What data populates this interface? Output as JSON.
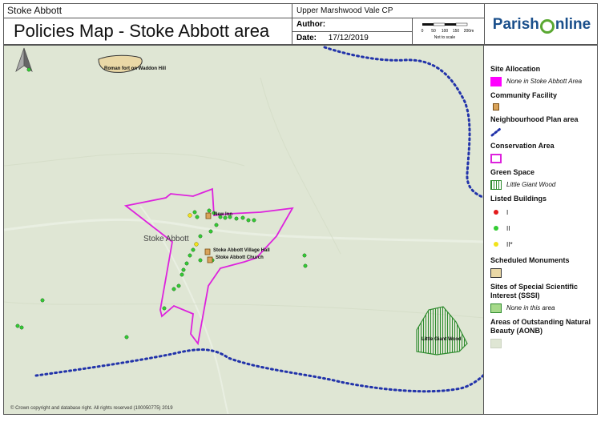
{
  "header": {
    "parish_small": "Stoke Abbott",
    "title": "Policies Map - Stoke Abbott area",
    "parish_cp": "Upper Marshwood Vale CP",
    "author_label": "Author:",
    "date_label": "Date:",
    "date_value": "17/12/2019",
    "scale_ticks": [
      "0",
      "50",
      "100",
      "150",
      "200m"
    ],
    "scale_note": "Not to scale",
    "logo_left": "Parish",
    "logo_right": "nline"
  },
  "map": {
    "labels": {
      "roman_fort": "Roman fort on Waddon Hill",
      "new_inn": "New Inn",
      "village_hall": "Stoke Abbott Village Hall",
      "church": "Stoke Abbott Church",
      "little_giant_wood": "Little Giant Wood",
      "place_name": "Stoke Abbott"
    },
    "copyright": "© Crown copyright and database right. All rights reserved (100050775) 2019"
  },
  "legend": {
    "site_allocation": "Site Allocation",
    "site_allocation_note": "None in Stoke Abbott Area",
    "community_facility": "Community Facility",
    "neighbourhood_plan_area": "Neighbourhood Plan area",
    "conservation_area": "Conservation Area",
    "green_space": "Green Space",
    "green_space_item": "Little Giant Wood",
    "listed_buildings": "Listed Buildings",
    "grade_1": "I",
    "grade_2": "II",
    "grade_2star": "II*",
    "scheduled_monuments": "Scheduled Monuments",
    "sssi": "Sites of Special Scientific Interest (SSSI)",
    "sssi_note": "None in this area",
    "aonb": "Areas of Outstanding Natural Beauty (AONB)"
  },
  "colors": {
    "site_allocation": "#ff00ff",
    "community_facility": "#d9a35a",
    "neighbourhood_plan": "#2233aa",
    "conservation_area": "#dd22dd",
    "green_space": "#2e8b2e",
    "grade_1": "#e31a1c",
    "grade_2": "#33cc33",
    "grade_2star": "#f2e31a",
    "scheduled_monument": "#ead8a6",
    "aonb": "#dfe6d4"
  }
}
